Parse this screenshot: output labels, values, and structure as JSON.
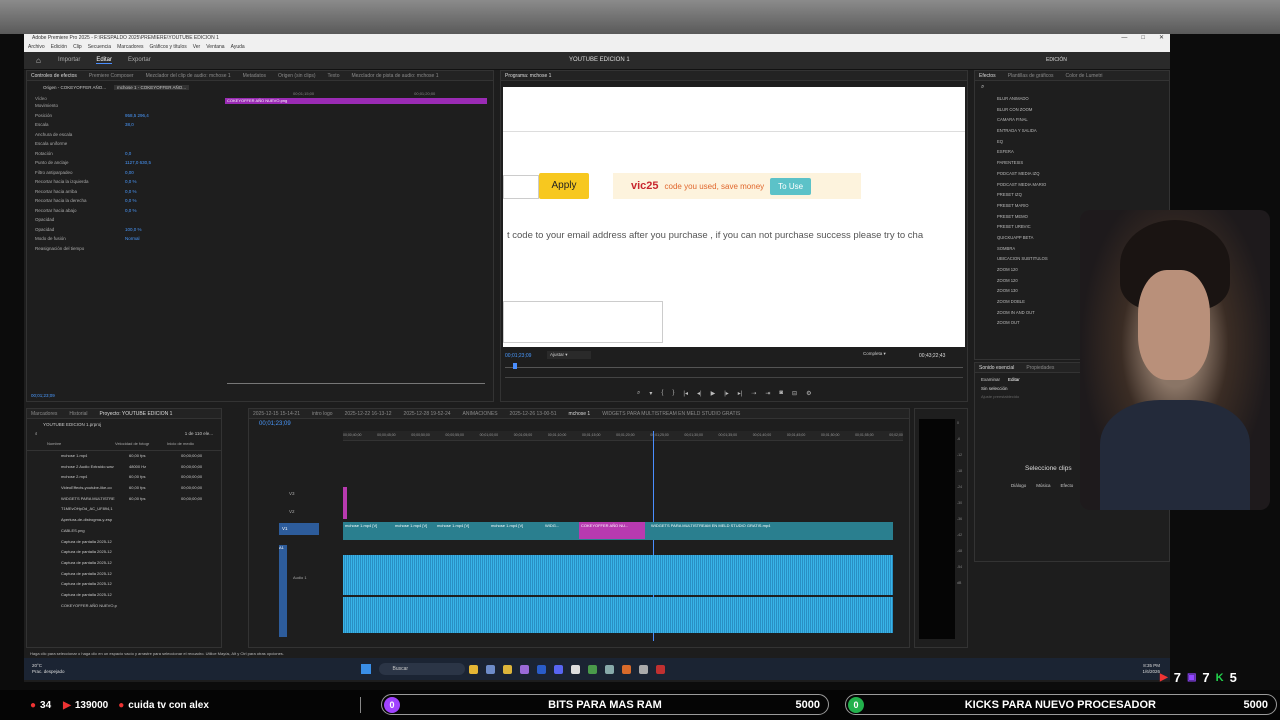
{
  "window": {
    "title": "Adobe Premiere Pro 2025 - F:\\RESPALDO 2025\\PREMIERE\\YOUTUBE EDICION 1",
    "controls": [
      "—",
      "□",
      "✕"
    ]
  },
  "menu": [
    "Archivo",
    "Edición",
    "Clip",
    "Secuencia",
    "Marcadores",
    "Gráficos y títulos",
    "Ver",
    "Ventana",
    "Ayuda"
  ],
  "workspace": {
    "tabs": [
      "Importar",
      "Editar",
      "Exportar"
    ],
    "active": "Editar",
    "center_title": "YOUTUBE EDICION 1",
    "right_label": "EDICIÓN"
  },
  "effect_controls": {
    "tabs": [
      "Controles de efectos",
      "Premiere Composer",
      "Mezclador del clip de audio: mchose 1",
      "Metadatos",
      "Origen (sin clips)",
      "Texto",
      "Mezclador de pista de audio: mchose 1"
    ],
    "source": "Origen - COKEYOFFER AÑO...",
    "sequence": "mchose 1 - COKEYOFFER AÑO...",
    "ruler": [
      "00;01;15;00",
      "00;01;20;00"
    ],
    "clip_name": "COKEYOFFER AÑO NUEVO.png",
    "section_video": "Vídeo",
    "rows": [
      {
        "name": "Movimiento",
        "value": ""
      },
      {
        "name": "Posición",
        "value": "958,5   296,4"
      },
      {
        "name": "Escala",
        "value": "38,0"
      },
      {
        "name": "Anchura de escala",
        "value": ""
      },
      {
        "name": "Escala uniforme",
        "value": ""
      },
      {
        "name": "Rotación",
        "value": "0,0"
      },
      {
        "name": "Punto de anclaje",
        "value": "1127,0   630,5"
      },
      {
        "name": "Filtro antiparpadeo",
        "value": "0,00"
      },
      {
        "name": "Recortar hacia la izquierda",
        "value": "0,0 %"
      },
      {
        "name": "Recortar hacia arriba",
        "value": "0,0 %"
      },
      {
        "name": "Recortar hacia la derecha",
        "value": "0,0 %"
      },
      {
        "name": "Recortar hacia abajo",
        "value": "0,0 %"
      },
      {
        "name": "Opacidad",
        "value": ""
      },
      {
        "name": "Opacidad",
        "value": "100,0 %"
      },
      {
        "name": "Modo de fusión",
        "value": "Normal"
      },
      {
        "name": "Reasignación del tiempo",
        "value": ""
      }
    ],
    "timecode": "00;01;23;09"
  },
  "program": {
    "tab": "Programa: mchose 1",
    "apply_label": "Apply",
    "promo_code": "vic25",
    "promo_text": "code you used, save money",
    "to_use_label": "To Use",
    "notice": "t code to your email address after you purchase , if you can not purchase success please try to cha",
    "timecode": "00;01;23;09",
    "fit": "Ajustar",
    "quality": "Completa",
    "duration": "00;43;22;43"
  },
  "effects_panel": {
    "tabs": [
      "Efectos",
      "Plantillas de gráficos",
      "Color de Lumetri"
    ],
    "items": [
      "BLUR ANIMADO",
      "BLUR CON ZOOM",
      "CAMARA FINAL",
      "ENTRADA Y SALIDA",
      "EQ",
      "ESFERA",
      "PARENTESIS",
      "PODCAST MEDIA IZQ",
      "PODCAST MEDIA MARIO",
      "PRESET IZQ",
      "PRESET MARIO",
      "PRESET MEMO",
      "PRESET URBVIC",
      "QUICKUAPP BETA",
      "SOMBRA",
      "UBICACION SUBTITULOS",
      "ZOOM 120",
      "ZOOM 120",
      "ZOOM 130",
      "ZOOM DOBLE",
      "ZOOM IN AND OUT",
      "ZOOM OUT"
    ]
  },
  "essential_sound": {
    "tabs": [
      "Sonido esencial",
      "Propiedades"
    ],
    "subtabs": [
      "Examinar",
      "Editar"
    ],
    "none": "Sin selección",
    "preset": "Ajuste preestablecido",
    "prompt": "Seleccione clips",
    "dialog": "Diálogo",
    "music": "Música",
    "sfx": "Efecto"
  },
  "project": {
    "tabs": [
      "Marcadores",
      "Historial",
      "Proyecto: YOUTUBE EDICION 1"
    ],
    "file": "YOUTUBE EDICION 1.prproj",
    "count": "1 de 110 ele...",
    "columns": [
      "Nombre",
      "Velocidad de fotogr",
      "Inicio de medio"
    ],
    "items": [
      {
        "name": "mchose 1.mp4",
        "fps": "60,00 fps",
        "start": "00;00;00;00"
      },
      {
        "name": "mchose 2 Audio Extraído.wav",
        "fps": "48000 Hz",
        "start": "00;00;00;00"
      },
      {
        "name": "mchose 2.mp4",
        "fps": "60,00 fps",
        "start": "00;00;00;00"
      },
      {
        "name": "VideoEffects-youtube-like-co",
        "fps": "60,00 fps",
        "start": "00;00;00;00"
      },
      {
        "name": "WIDGETS PARA MULTISTRE",
        "fps": "60,00 fps",
        "start": "00;00;00;00"
      },
      {
        "name": "T1MEvOHpOd_AC_UF894,1",
        "fps": "",
        "start": ""
      },
      {
        "name": "Apertura-de-distrogma-y-esp",
        "fps": "",
        "start": ""
      },
      {
        "name": "CABLES.png",
        "fps": "",
        "start": ""
      },
      {
        "name": "Captura de pantalla 2025-12",
        "fps": "",
        "start": ""
      },
      {
        "name": "Captura de pantalla 2025-12",
        "fps": "",
        "start": ""
      },
      {
        "name": "Captura de pantalla 2025-12",
        "fps": "",
        "start": ""
      },
      {
        "name": "Captura de pantalla 2025-12",
        "fps": "",
        "start": ""
      },
      {
        "name": "Captura de pantalla 2025-12",
        "fps": "",
        "start": ""
      },
      {
        "name": "Captura de pantalla 2025-12",
        "fps": "",
        "start": ""
      },
      {
        "name": "COKEYOFFER AÑO NUEVO.p",
        "fps": "",
        "start": ""
      }
    ]
  },
  "timeline": {
    "tabs": [
      "2025-12-15 15-14-21",
      "intro logo",
      "2025-12-22 16-13-12",
      "2025-12-28 19-52-24",
      "ANIMACIONES",
      "2025-12-26 13-00-51",
      "mchose 1",
      "WIDGETS PARA MULTISTREAM EN MELD STUDIO GRATIS"
    ],
    "timecode": "00;01;23;09",
    "ruler": [
      "00;00;40;00",
      "00;00;45;00",
      "00;00;50;00",
      "00;00;55;00",
      "00;01;00;00",
      "00;01;05;00",
      "00;01;10;00",
      "00;01;15;00",
      "00;01;20;00",
      "00;01;25;00",
      "00;01;30;00",
      "00;01;35;00",
      "00;01;40;00",
      "00;01;45;00",
      "00;01;50;00",
      "00;01;55;00",
      "00;02;00"
    ],
    "tracks": [
      "V3",
      "V2",
      "V1",
      "A1"
    ],
    "audio_label": "Audio 1",
    "clips": [
      "mchose 1.mp4 [V]",
      "mchose 1.mp4 [V]",
      "mchose 1.mp4 [V]",
      "mchose 1.mp4 [V]",
      "WIDG...",
      "COKEYOFFER AÑO NU...",
      "WIDGETS PARA MULTISTREAM EN MELD STUDIO GRATIS.mp4"
    ]
  },
  "meter_scale": [
    "0",
    "-6",
    "-12",
    "-18",
    "-24",
    "-30",
    "-36",
    "-42",
    "-48",
    "-54",
    "dB"
  ],
  "status": "Haga clic para seleccionar o haga clic en un espacio vacío y arrastre para seleccionar el recuadro. Utilice Mayús, Alt y Ctrl para otras opciones.",
  "taskbar": {
    "weather_temp": "20°C",
    "weather_desc": "Prac. despejado",
    "search": "Buscar",
    "time": "8:35 PM",
    "date": "1/6/2026"
  },
  "stream_overlay": {
    "viewers": "34",
    "subs": "139000",
    "channel": "cuida tv con alex",
    "goal1": {
      "count": "0",
      "label": "BITS PARA MAS RAM",
      "target": "5000"
    },
    "goal2": {
      "count": "0",
      "label": "KICKS PARA NUEVO PROCESADOR",
      "target": "5000"
    },
    "yt_count": "7",
    "twitch_count": "7",
    "kick_count": "5"
  },
  "colors": {
    "accent": "#4a8eff",
    "clip_v": "#2a7f8f",
    "clip_pink": "#b83ab0",
    "audio": "#38b5e8",
    "goal1": "#a042ff",
    "goal2": "#22b14c"
  }
}
